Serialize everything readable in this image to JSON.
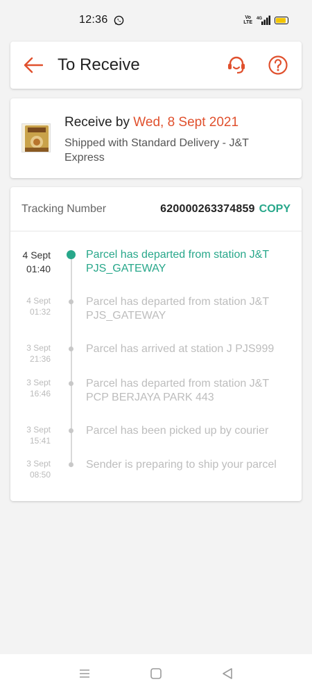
{
  "status_bar": {
    "time": "12:36",
    "network_label_top": "Vo",
    "network_label_bottom": "LTE",
    "network_type": "4G",
    "battery_level": 0.85,
    "battery_color": "#f2c400"
  },
  "header": {
    "title": "To Receive",
    "accent_color": "#e0502d",
    "icons": [
      "back-arrow-icon",
      "customer-support-icon",
      "help-icon"
    ]
  },
  "delivery": {
    "receive_prefix": "Receive by ",
    "receive_date": "Wed, 8 Sept 2021",
    "shipping_info": "Shipped with Standard Delivery  - J&T Express"
  },
  "tracking": {
    "label": "Tracking Number",
    "number": "620000263374859",
    "copy_label": "COPY",
    "events": [
      {
        "date": "4 Sept",
        "time": "01:40",
        "description": "Parcel has departed from station J&T PJS_GATEWAY",
        "active": true
      },
      {
        "date": "4 Sept",
        "time": "01:32",
        "description": "Parcel has departed from station J&T PJS_GATEWAY",
        "active": false
      },
      {
        "date": "3 Sept",
        "time": "21:36",
        "description": "Parcel has arrived at station J PJS999",
        "active": false
      },
      {
        "date": "3 Sept",
        "time": "16:46",
        "description": "Parcel has departed from station J&T PCP BERJAYA PARK 443",
        "active": false
      },
      {
        "date": "3 Sept",
        "time": "15:41",
        "description": "Parcel has been picked up by courier",
        "active": false
      },
      {
        "date": "3 Sept",
        "time": "08:50",
        "description": "Sender is preparing to ship your parcel",
        "active": false
      }
    ],
    "active_color": "#27a78a"
  },
  "nav_bar": {
    "icons": [
      "menu-icon",
      "home-square-icon",
      "back-triangle-icon"
    ]
  }
}
